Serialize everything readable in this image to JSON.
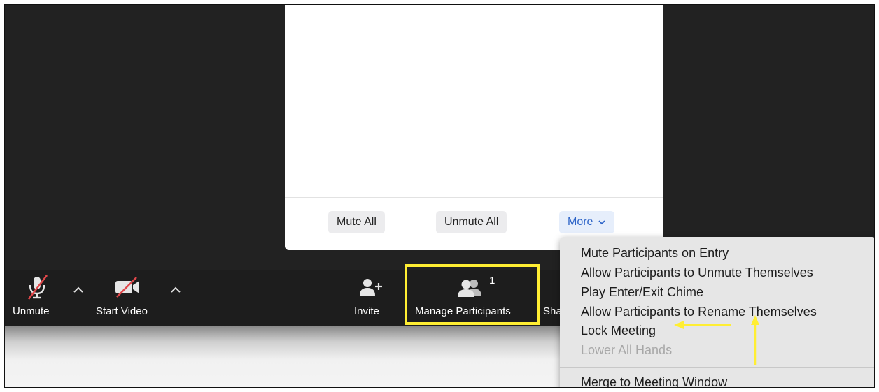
{
  "panel": {
    "mute_all": "Mute All",
    "unmute_all": "Unmute All",
    "more": "More",
    "more_caret": "⌄"
  },
  "toolbar": {
    "unmute": "Unmute",
    "start_video": "Start Video",
    "invite": "Invite",
    "manage_participants": "Manage Participants",
    "participant_count": "1",
    "share_partial": "Sha",
    "caret": "^"
  },
  "menu": {
    "items": [
      {
        "label": "Mute Participants on Entry",
        "enabled": true
      },
      {
        "label": "Allow Participants to Unmute Themselves",
        "enabled": true
      },
      {
        "label": "Play Enter/Exit Chime",
        "enabled": true
      },
      {
        "label": "Allow Participants to Rename Themselves",
        "enabled": true
      },
      {
        "label": "Lock Meeting",
        "enabled": true
      },
      {
        "label": "Lower All Hands",
        "enabled": false
      }
    ],
    "merge": "Merge to Meeting Window"
  },
  "annotation_color": "#ffee33"
}
